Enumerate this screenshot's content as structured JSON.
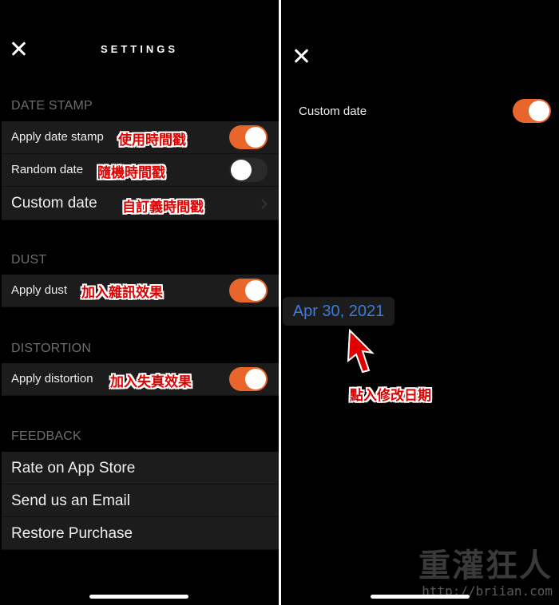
{
  "left": {
    "title": "SETTINGS",
    "sections": {
      "date_stamp": {
        "header": "DATE STAMP",
        "apply_label": "Apply date stamp",
        "apply_anno": "使用時間戳",
        "apply_on": true,
        "random_label": "Random date",
        "random_anno": "隨機時間戳",
        "random_on": false,
        "custom_label": "Custom date",
        "custom_anno": "自訂義時間戳"
      },
      "dust": {
        "header": "DUST",
        "apply_label": "Apply dust",
        "apply_anno": "加入雜訊效果",
        "apply_on": true
      },
      "distortion": {
        "header": "DISTORTION",
        "apply_label": "Apply distortion",
        "apply_anno": "加入失真效果",
        "apply_on": true
      },
      "feedback": {
        "header": "FEEDBACK",
        "items": [
          "Rate on App Store",
          "Send us an Email",
          "Restore Purchase"
        ]
      }
    }
  },
  "right": {
    "custom_date_label": "Custom date",
    "custom_date_on": true,
    "date_value": "Apr 30, 2021",
    "tap_anno": "點入修改日期"
  },
  "watermark": {
    "name": "重灌狂人",
    "url": "http://briian.com"
  },
  "colors": {
    "accent": "#e8662c",
    "date_link": "#3d7bd9",
    "annotation": "#e00000"
  }
}
